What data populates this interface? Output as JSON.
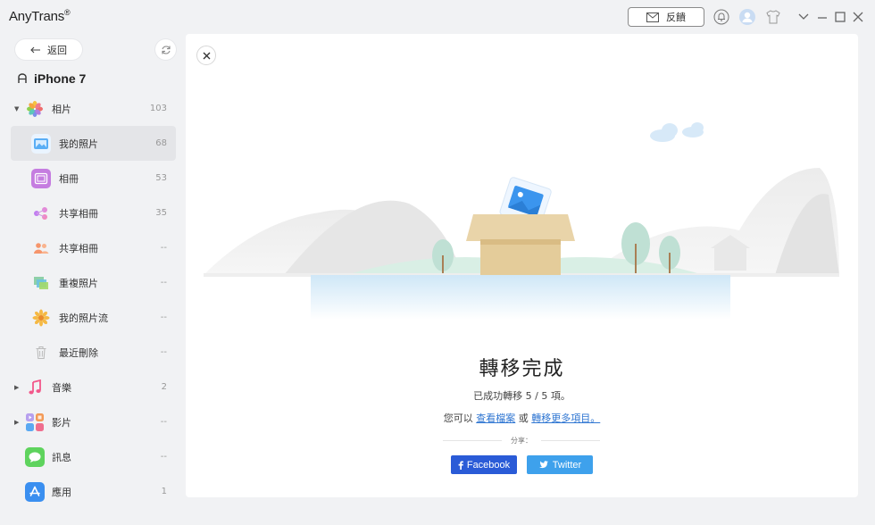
{
  "app": {
    "name": "AnyTrans",
    "reg": "®"
  },
  "toolbar": {
    "feedback_label": "反饋"
  },
  "sidebar": {
    "back_label": "返回",
    "device_name": "iPhone 7",
    "items": [
      {
        "label": "相片",
        "count": "103",
        "icon": "photos-icon",
        "level": "top",
        "expandable": true,
        "expanded": true
      },
      {
        "label": "我的照片",
        "count": "68",
        "icon": "my-photos-icon",
        "level": "sub",
        "active": true
      },
      {
        "label": "相冊",
        "count": "53",
        "icon": "album-icon",
        "level": "sub"
      },
      {
        "label": "共享相冊",
        "count": "35",
        "icon": "shared-album-icon",
        "level": "sub"
      },
      {
        "label": "共享相冊",
        "count": "--",
        "icon": "people-icon",
        "level": "sub"
      },
      {
        "label": "重複照片",
        "count": "--",
        "icon": "duplicate-photos-icon",
        "level": "sub"
      },
      {
        "label": "我的照片流",
        "count": "--",
        "icon": "photo-stream-icon",
        "level": "sub"
      },
      {
        "label": "最近刪除",
        "count": "--",
        "icon": "trash-icon",
        "level": "sub"
      },
      {
        "label": "音樂",
        "count": "2",
        "icon": "music-icon",
        "level": "top",
        "expandable": true
      },
      {
        "label": "影片",
        "count": "--",
        "icon": "video-icon",
        "level": "top",
        "expandable": true
      },
      {
        "label": "訊息",
        "count": "--",
        "icon": "messages-icon",
        "level": "top"
      },
      {
        "label": "應用",
        "count": "1",
        "icon": "app-store-icon",
        "level": "top"
      }
    ]
  },
  "main": {
    "title": "轉移完成",
    "message": "已成功轉移 5 / 5 項。",
    "links_prefix": "您可以",
    "link_view": "查看檔案",
    "links_or": "或",
    "link_more": "轉移更多項目。",
    "share_label": "分享：",
    "facebook_label": "Facebook",
    "twitter_label": "Twitter"
  },
  "colors": {
    "facebook": "#2a5bd7",
    "twitter": "#3ea1ec",
    "link": "#2f76d2"
  }
}
